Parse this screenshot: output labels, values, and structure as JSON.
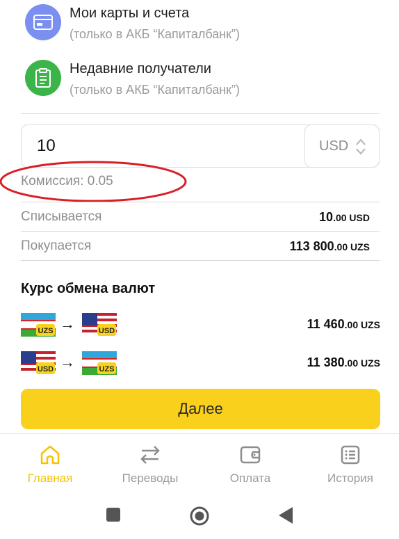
{
  "options": [
    {
      "title": "Мои карты и счета",
      "subtitle": "(только в АКБ “Капиталбанк”)",
      "icon": "card-icon",
      "color": "#7b8ff0"
    },
    {
      "title": "Недавние получатели",
      "subtitle": "(только в АКБ “Капиталбанк”)",
      "icon": "clipboard-icon",
      "color": "#3bb54a"
    }
  ],
  "amount": {
    "value": "10",
    "currency": "USD"
  },
  "commission": "Комиссия: 0.05",
  "summary": {
    "debit_label": "Списывается",
    "debit_int": "10",
    "debit_dec": ".00 USD",
    "credit_label": "Покупается",
    "credit_int": "113 800",
    "credit_dec": ".00 UZS"
  },
  "rates": {
    "title": "Курс обмена валют",
    "rows": [
      {
        "from": "UZS",
        "to": "USD",
        "value_int": "11 460",
        "value_dec": ".00 UZS"
      },
      {
        "from": "USD",
        "to": "UZS",
        "value_int": "11 380",
        "value_dec": ".00 UZS"
      }
    ]
  },
  "next_button": "Далее",
  "nav": [
    {
      "label": "Главная",
      "icon": "home-icon",
      "active": true
    },
    {
      "label": "Переводы",
      "icon": "transfer-icon",
      "active": false
    },
    {
      "label": "Оплата",
      "icon": "wallet-icon",
      "active": false
    },
    {
      "label": "История",
      "icon": "history-icon",
      "active": false
    }
  ],
  "colors": {
    "accent": "#f9d11c",
    "active_nav": "#f4c400",
    "annotation": "#d81f26"
  }
}
